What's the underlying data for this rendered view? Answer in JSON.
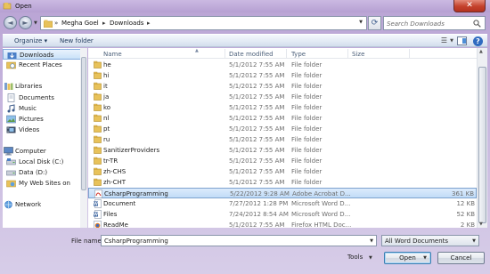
{
  "window": {
    "title": "Open",
    "close_label": "✕"
  },
  "address": {
    "crumbs": [
      "Megha Goel",
      "Downloads"
    ],
    "search_placeholder": "Search Downloads"
  },
  "toolbar": {
    "organize_label": "Organize ▾",
    "new_folder_label": "New folder"
  },
  "nav": {
    "items": [
      {
        "label": "Downloads",
        "icon": "downloads-folder-icon",
        "selected": true
      },
      {
        "label": "Recent Places",
        "icon": "recent-places-icon"
      },
      {
        "label": "Libraries",
        "icon": "libraries-icon"
      },
      {
        "label": "Documents",
        "icon": "documents-icon"
      },
      {
        "label": "Music",
        "icon": "music-icon"
      },
      {
        "label": "Pictures",
        "icon": "pictures-icon"
      },
      {
        "label": "Videos",
        "icon": "videos-icon"
      },
      {
        "label": "Computer",
        "icon": "computer-icon"
      },
      {
        "label": "Local Disk (C:)",
        "icon": "local-disk-icon"
      },
      {
        "label": "Data (D:)",
        "icon": "drive-icon"
      },
      {
        "label": "My Web Sites on",
        "icon": "web-sites-icon"
      },
      {
        "label": "Network",
        "icon": "network-icon"
      }
    ]
  },
  "columns": {
    "name": "Name",
    "date": "Date modified",
    "type": "Type",
    "size": "Size"
  },
  "files": [
    {
      "name": "he",
      "date": "5/1/2012 7:55 AM",
      "type": "File folder",
      "size": "",
      "kind": "folder"
    },
    {
      "name": "hi",
      "date": "5/1/2012 7:55 AM",
      "type": "File folder",
      "size": "",
      "kind": "folder"
    },
    {
      "name": "it",
      "date": "5/1/2012 7:55 AM",
      "type": "File folder",
      "size": "",
      "kind": "folder"
    },
    {
      "name": "ja",
      "date": "5/1/2012 7:55 AM",
      "type": "File folder",
      "size": "",
      "kind": "folder"
    },
    {
      "name": "ko",
      "date": "5/1/2012 7:55 AM",
      "type": "File folder",
      "size": "",
      "kind": "folder"
    },
    {
      "name": "nl",
      "date": "5/1/2012 7:55 AM",
      "type": "File folder",
      "size": "",
      "kind": "folder"
    },
    {
      "name": "pt",
      "date": "5/1/2012 7:55 AM",
      "type": "File folder",
      "size": "",
      "kind": "folder"
    },
    {
      "name": "ru",
      "date": "5/1/2012 7:55 AM",
      "type": "File folder",
      "size": "",
      "kind": "folder"
    },
    {
      "name": "SanitizerProviders",
      "date": "5/1/2012 7:55 AM",
      "type": "File folder",
      "size": "",
      "kind": "folder"
    },
    {
      "name": "tr-TR",
      "date": "5/1/2012 7:55 AM",
      "type": "File folder",
      "size": "",
      "kind": "folder"
    },
    {
      "name": "zh-CHS",
      "date": "5/1/2012 7:55 AM",
      "type": "File folder",
      "size": "",
      "kind": "folder"
    },
    {
      "name": "zh-CHT",
      "date": "5/1/2012 7:55 AM",
      "type": "File folder",
      "size": "",
      "kind": "folder"
    },
    {
      "name": "CsharpProgramming",
      "date": "5/22/2012 9:28 AM",
      "type": "Adobe Acrobat D...",
      "size": "361 KB",
      "kind": "pdf",
      "selected": true
    },
    {
      "name": "Document",
      "date": "7/27/2012 1:28 PM",
      "type": "Microsoft Word D...",
      "size": "12 KB",
      "kind": "word"
    },
    {
      "name": "Files",
      "date": "7/24/2012 8:54 AM",
      "type": "Microsoft Word D...",
      "size": "52 KB",
      "kind": "word"
    },
    {
      "name": "ReadMe",
      "date": "5/1/2012 7:55 AM",
      "type": "Firefox HTML Doc...",
      "size": "2 KB",
      "kind": "html"
    }
  ],
  "bottom": {
    "filename_label": "File name:",
    "filename_value": "CsharpProgramming",
    "filter_value": "All Word Documents",
    "tools_label": "Tools",
    "open_label": "Open",
    "cancel_label": "Cancel"
  },
  "colors": {
    "selection": "#c1dcf7",
    "accent": "#3c7fb1",
    "folder": "#e8c25a",
    "title_close": "#c4412c"
  }
}
